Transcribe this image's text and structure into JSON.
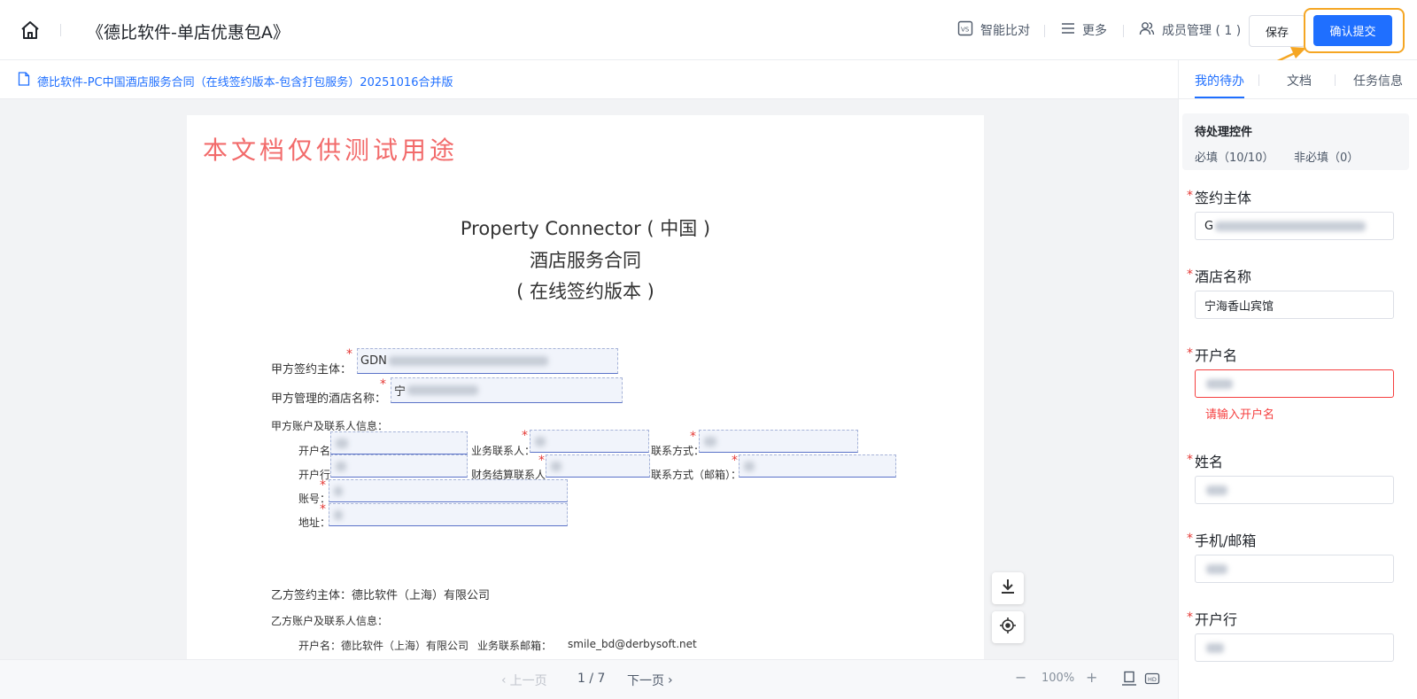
{
  "header": {
    "title": "《德比软件-单店优惠包A》",
    "compare_label": "智能比对",
    "more_label": "更多",
    "members_label": "成员管理 ( 1 )",
    "save_label": "保存",
    "submit_label": "确认提交",
    "highlight_color": "#f5a623",
    "primary_color": "#1f6fff"
  },
  "docbar": {
    "file_name": "德比软件-PC中国酒店服务合同（在线签约版本-包含打包服务）20251016合并版"
  },
  "document": {
    "watermark": "本文档仅供测试用途",
    "title_line1": "Property Connector ( 中国 )",
    "title_line2": "酒店服务合同",
    "title_line3": "( 在线签约版本 )",
    "party_a_label": "甲方签约主体：",
    "party_a_value": "GDN",
    "hotel_name_label": "甲方管理的酒店名称：",
    "hotel_name_value": "宁",
    "party_a_account_title": "甲方账户及联系人信息：",
    "account_name_label": "开户名",
    "bank_label": "开户行",
    "account_no_label": "账号：",
    "address_label": "地址：",
    "biz_contact_label": "业务联系人：",
    "finance_contact_label": "财务结算联系人",
    "contact_method_label": "联系方式：",
    "contact_email_label": "联系方式（邮箱）：",
    "party_b_label": "乙方签约主体：德比软件（上海）有限公司",
    "party_b_account_title": "乙方账户及联系人信息：",
    "party_b_account_line": "开户名：德比软件（上海）有限公司",
    "party_b_biz_email_label": "业务联系邮箱：",
    "party_b_biz_email": "smile_bd@derbysoft.net"
  },
  "pager": {
    "prev_label": "上一页",
    "page_indicator": "1 / 7",
    "next_label": "下一页",
    "zoom_level": "100%"
  },
  "panel": {
    "tabs": [
      {
        "label": "我的待办"
      },
      {
        "label": "文档"
      },
      {
        "label": "任务信息"
      }
    ],
    "pending_title": "待处理控件",
    "required_count": "必填（10/10）",
    "optional_count": "非必填（0）",
    "fields": [
      {
        "label": "签约主体",
        "value": "G"
      },
      {
        "label": "酒店名称",
        "value": "宁海香山宾馆"
      },
      {
        "label": "开户名",
        "value": "",
        "error": "请输入开户名"
      },
      {
        "label": "姓名",
        "value": ""
      },
      {
        "label": "手机/邮箱",
        "value": ""
      },
      {
        "label": "开户行",
        "value": ""
      }
    ]
  }
}
